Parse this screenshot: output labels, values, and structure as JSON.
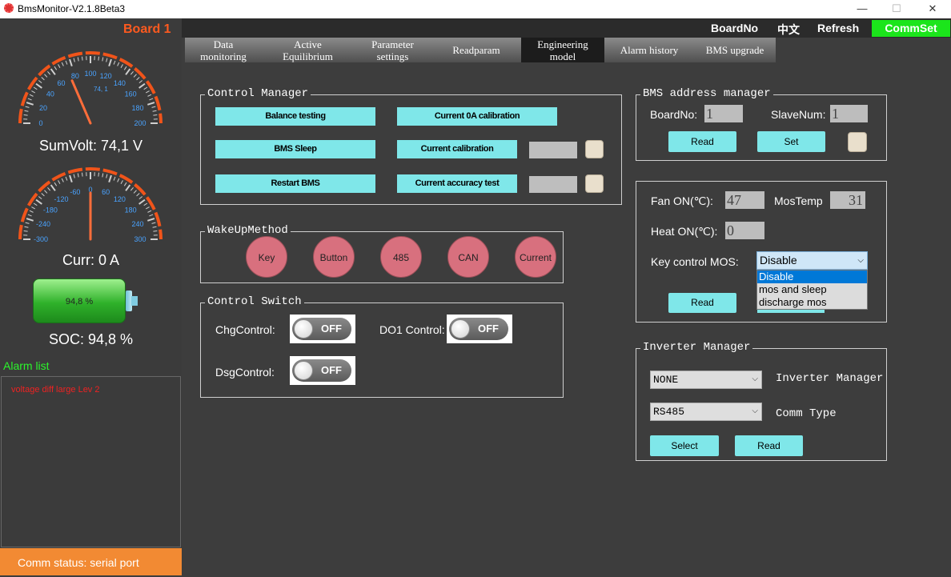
{
  "window": {
    "title": "BmsMonitor-V2.1.8Beta3",
    "minimize": "—",
    "maximize": "☐",
    "close": "✕"
  },
  "left": {
    "board": "Board 1",
    "sumvolt": {
      "label": "SumVolt: 74,1 V",
      "value": 74.1,
      "ticks": [
        "0",
        "20",
        "40",
        "60",
        "80",
        "100",
        "120",
        "140",
        "160",
        "180",
        "200"
      ],
      "center_text": "74, 1"
    },
    "curr": {
      "label": "Curr: 0 A",
      "value": 0,
      "ticks": [
        "-300",
        "-240",
        "-180",
        "-120",
        "-60",
        "0",
        "60",
        "120",
        "180",
        "240",
        "300"
      ]
    },
    "battery": {
      "percent_text": "94,8 %",
      "level": 0.948
    },
    "soc": "SOC: 94,8 %",
    "alarm_title": "Alarm list",
    "alarm_items": [
      "voltage diff large Lev 2"
    ],
    "comm_status": "Comm status: serial port"
  },
  "top": {
    "boardno": "BoardNo",
    "lang": "中文",
    "refresh": "Refresh",
    "commset": "CommSet"
  },
  "tabs": [
    {
      "l1": "Data",
      "l2": "monitoring"
    },
    {
      "l1": "Active",
      "l2": "Equilibrium"
    },
    {
      "l1": "Parameter",
      "l2": "settings"
    },
    {
      "l1": "Readparam",
      "l2": ""
    },
    {
      "l1": "Engineering",
      "l2": "model"
    },
    {
      "l1": "Alarm history",
      "l2": ""
    },
    {
      "l1": "BMS upgrade",
      "l2": ""
    }
  ],
  "control_manager": {
    "title": "Control Manager",
    "balance": "Balance testing",
    "cur0": "Current 0A calibration",
    "sleep": "BMS Sleep",
    "curcal": "Current calibration",
    "restart": "Restart BMS",
    "curacc": "Current accuracy test"
  },
  "wakeup": {
    "title": "WakeUpMethod",
    "buttons": [
      "Key",
      "Button",
      "485",
      "CAN",
      "Current"
    ]
  },
  "control_switch": {
    "title": "Control Switch",
    "chg": "ChgControl:",
    "do1": "DO1 Control:",
    "dsg": "DsgControl:",
    "off": "OFF"
  },
  "bms_addr": {
    "title": "BMS address manager",
    "boardno_label": "BoardNo:",
    "boardno": "1",
    "slave_label": "SlaveNum:",
    "slave": "1",
    "read": "Read",
    "set": "Set"
  },
  "fan": {
    "fan_label": "Fan ON(℃):",
    "fan": "47",
    "mostemp_label": "MosTemp",
    "mostemp": "31",
    "heat_label": "Heat ON(℃):",
    "heat": "0",
    "keymos_label": "Key control MOS:",
    "keymos": "Disable",
    "options": [
      "Disable",
      "mos and sleep",
      "discharge mos"
    ],
    "read": "Read"
  },
  "inverter": {
    "title": "Inverter Manager",
    "type": "NONE",
    "type_label": "Inverter Manager",
    "comm": "RS485",
    "comm_label": "Comm Type",
    "select": "Select",
    "read": "Read"
  }
}
